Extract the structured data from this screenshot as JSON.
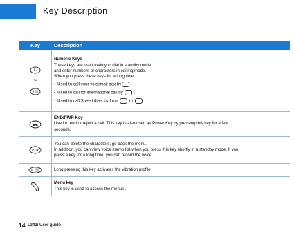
{
  "header": {
    "title": "Key Description"
  },
  "table": {
    "col_key": "Key",
    "col_description": "Description",
    "rows": [
      {
        "key_icons": [
          "key-1-voicemail-icon",
          "key-9-icon"
        ],
        "tilde": "~",
        "title": "Numeric Keys",
        "lines": [
          "These keys are used mainly to dial in standby mode",
          "and enter numbers or characters in editing mode.",
          "When you press these keys for a long time."
        ],
        "bullets": [
          "Used to call your voicemail box by",
          "Used to call for international call by",
          "Used to call Speed dials by from"
        ],
        "bullet_3_mid": "to",
        "bullet_end": "."
      },
      {
        "key_icons": [
          "end-pwr-key-icon"
        ],
        "title": "END/PWR Key",
        "lines": [
          "Used to end or reject a call. This key is also used as Power Key by pressing this key for a few",
          "seconds."
        ]
      },
      {
        "key_icons": [
          "clear-key-icon"
        ],
        "lines": [
          "You can delete the characters, go back the menu.",
          "In addition, you can view voice memo list when you press this key shortly in a standby mode. If you",
          "press a key for a long time, you can record the voice."
        ]
      },
      {
        "key_icons": [
          "hash-vibration-key-icon"
        ],
        "lines": [
          "Long pressing this key activates the vibration profile."
        ]
      },
      {
        "key_icons": [
          "menu-key-icon"
        ],
        "title": "Menu key",
        "lines": [
          "This key is used to access the menus ."
        ]
      }
    ]
  },
  "footer": {
    "page_number": "14",
    "guide": "L342i User guide"
  },
  "colors": {
    "accent": "#1a7ad4",
    "rule": "#9fb7d2"
  }
}
